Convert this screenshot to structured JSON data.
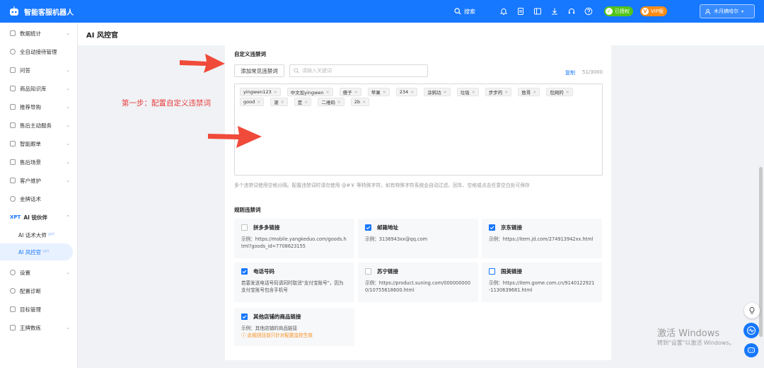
{
  "app": {
    "name": "智能客服机器人"
  },
  "header": {
    "search_label": "搜索",
    "badge_authorized": "已授权",
    "badge_vip": "VIP版",
    "vip_mark": "V",
    "user_name": "木月搞哈尔"
  },
  "sidebar": {
    "items": [
      {
        "label": "数据统计"
      },
      {
        "label": "全自动接待管理"
      },
      {
        "label": "问答"
      },
      {
        "label": "商品知识库"
      },
      {
        "label": "推荐导购"
      },
      {
        "label": "售后主动服务"
      },
      {
        "label": "智能跟单"
      },
      {
        "label": "售后场景"
      },
      {
        "label": "客户维护"
      },
      {
        "label": "金牌话术"
      }
    ],
    "group": {
      "prefix": "XPT",
      "label": "AI 锐伙伴"
    },
    "subitems": [
      {
        "label": "AI 话术大师",
        "sup": "XPT"
      },
      {
        "label": "AI 风控官",
        "sup": "XPT"
      }
    ],
    "items_after": [
      {
        "label": "设置"
      },
      {
        "label": "配置诊断"
      },
      {
        "label": "目标管理"
      },
      {
        "label": "王牌数练"
      }
    ]
  },
  "page": {
    "title": "AI 风控官"
  },
  "custom": {
    "title": "自定义违禁词",
    "add_button": "添加常见违禁词",
    "search_placeholder": "请输入关键词",
    "copy": "复制",
    "count": "51/3000",
    "tags": [
      "yingwen123",
      "中文加yingwen",
      "傻子",
      "苹果",
      "234",
      "涂鸦功",
      "垃圾",
      "步步的",
      "敖哥",
      "包网的",
      "good",
      "滚",
      "是",
      "二维码",
      "2b"
    ],
    "hint": "多个违禁词使用空格分隔。配置违禁词时请勿使用 @#￥ 等特殊字符，如有特殊字符系统会自动过滤，回车、空格或点击任意空白处可保存"
  },
  "annotation": "第一步：配置自定义违禁词",
  "rules": {
    "title": "规则违禁词",
    "cards": [
      {
        "title": "拼多多链接",
        "checked": false,
        "text": "示例：https://mobile.yangkeduo.com/goods.html?goods_id=7708623155"
      },
      {
        "title": "邮箱地址",
        "checked": true,
        "text": "示例：3136943xx@qq.com"
      },
      {
        "title": "京东链接",
        "checked": true,
        "text": "示例：https://item.jd.com/274913942xx.html"
      },
      {
        "title": "电话号码",
        "checked": true,
        "text": "若要发送电话号码请同时取消\"支付宝账号\"，因为支付宝账号包含手机号"
      },
      {
        "title": "苏宁链接",
        "checked": false,
        "text": "示例：https://product.suning.com/0000000000/10755618600.html"
      },
      {
        "title": "国美链接",
        "checked": false,
        "text": "示例：https://item.gome.com.cn/9140122921-1130639681.html"
      },
      {
        "title": "其他店铺的商品链接",
        "checked": true,
        "text": "示例：其他店铺的商品链接",
        "warn": "ⓘ 此规则目前只针对配置监控生效"
      }
    ]
  },
  "watermark": {
    "line1": "激活 Windows",
    "line2": "转到\"设置\"以激活 Windows。"
  },
  "colors": {
    "primary": "#1677ff",
    "annotation": "#e63c3c",
    "warning": "#fa8c16"
  }
}
